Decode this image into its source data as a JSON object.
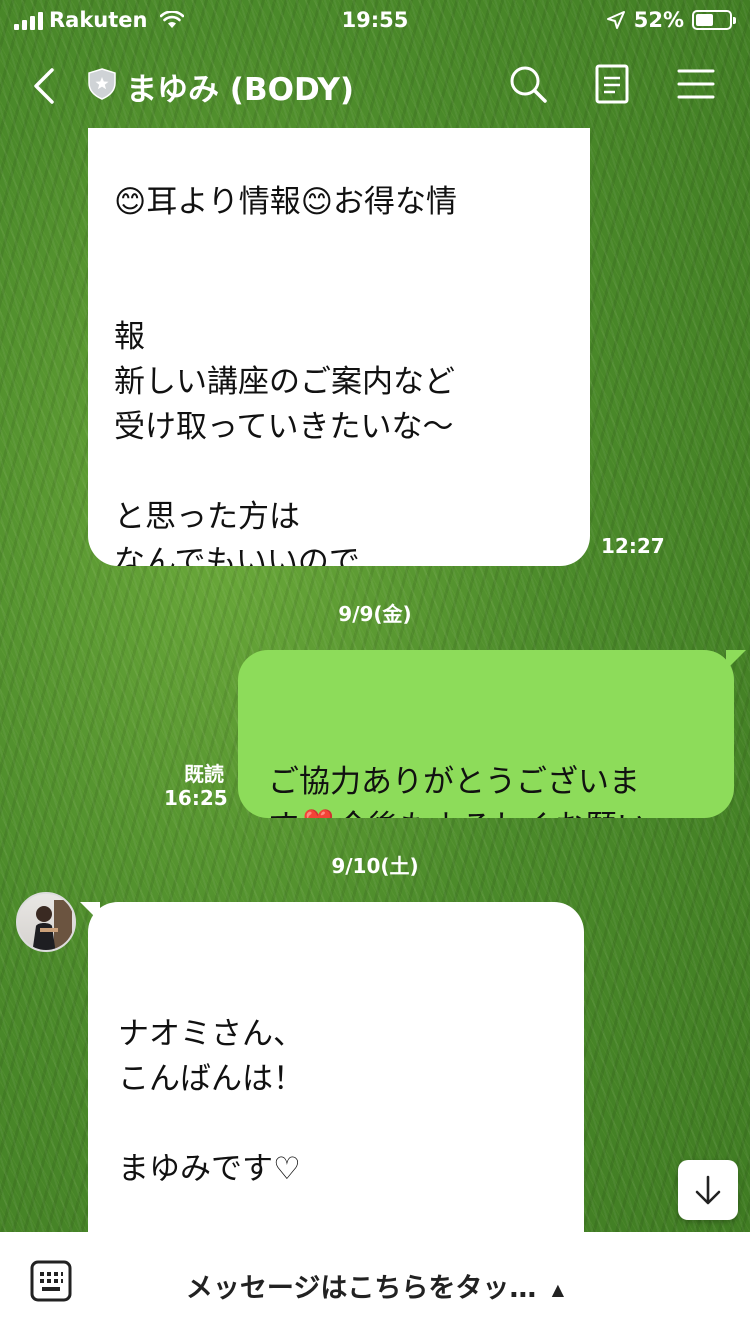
{
  "status_bar": {
    "carrier": "Rakuten",
    "time": "19:55",
    "battery": "52%",
    "battery_level": 0.52
  },
  "header": {
    "title": "まゆみ (BODY)",
    "icons": [
      "back-chevron-icon",
      "shield-icon",
      "search-icon",
      "notes-icon",
      "menu-icon"
    ]
  },
  "messages": [
    {
      "sender": "other",
      "text": "報\n新しい講座のご案内など\n受け取っていきたいな〜\n\nと思った方は\nなんでもいいので\n\n✨スタンプ✨返信してく\nださいね😊",
      "partial_top_line": "😊耳より情報😊お得な情",
      "time": "12:27"
    },
    {
      "date": "9/9(金)"
    },
    {
      "sender": "me",
      "text": "ご協力ありがとうございま\nす❣️今後もよろしくお願い\nしますね〜😊",
      "read": "既読",
      "time": "16:25"
    },
    {
      "date": "9/10(土)"
    },
    {
      "sender": "other",
      "text": "ナオミさん、\nこんばんは！\n\nまゆみです♡\n\n先日は\n超初心者向🔰手相講座！"
    }
  ],
  "input": {
    "placeholder": "メッセージはこちらをタッ…",
    "arrow": "▲"
  },
  "colors": {
    "my_bubble": "#8ddc5a",
    "other_bubble": "#ffffff",
    "header_text": "#ffffff"
  }
}
